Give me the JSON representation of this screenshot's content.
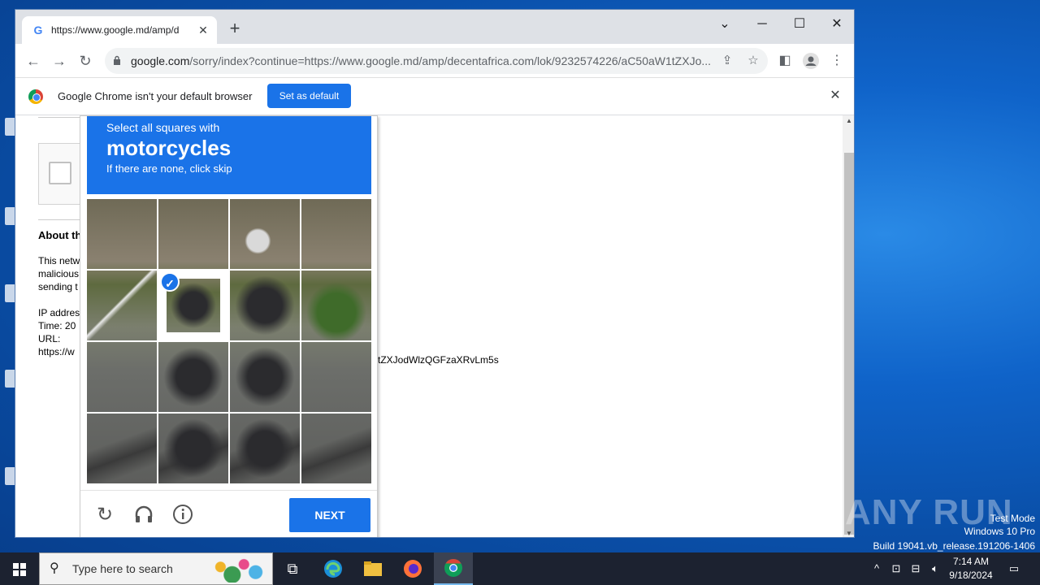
{
  "window": {
    "tab_title": "https://www.google.md/amp/d",
    "tab_favicon": "G",
    "url_host": "google.com",
    "url_path": "/sorry/index?continue=https://www.google.md/amp/decentafrica.com/lok/9232574226/aC50aW1tZXJo..."
  },
  "infobar": {
    "message": "Google Chrome isn't your default browser",
    "button": "Set as default"
  },
  "background_page": {
    "section_title": "About th",
    "line1": "This netw",
    "line2": "malicious",
    "line3": "sending t",
    "ip": "IP addres",
    "time": "Time: 20",
    "url_label": "URL:",
    "url_value": "https://w",
    "url_tail": "tZXJodWlzQGFzaXRvLm5s"
  },
  "challenge": {
    "line1": "Select all squares with",
    "keyword": "motorcycles",
    "line3": "If there are none, click skip",
    "next_button": "NEXT",
    "tiles": [
      {
        "selected": false
      },
      {
        "selected": false
      },
      {
        "selected": false
      },
      {
        "selected": false
      },
      {
        "selected": false
      },
      {
        "selected": true
      },
      {
        "selected": false
      },
      {
        "selected": false
      },
      {
        "selected": false
      },
      {
        "selected": false
      },
      {
        "selected": false
      },
      {
        "selected": false
      },
      {
        "selected": false
      },
      {
        "selected": false
      },
      {
        "selected": false
      },
      {
        "selected": false
      }
    ]
  },
  "desktop": {
    "watermark": "ANY RUN",
    "test_mode": "Test Mode",
    "os_name": "Windows 10 Pro",
    "build": "Build 19041.vb_release.191206-1406"
  },
  "taskbar": {
    "search_placeholder": "Type here to search",
    "time": "7:14 AM",
    "date": "9/18/2024"
  }
}
